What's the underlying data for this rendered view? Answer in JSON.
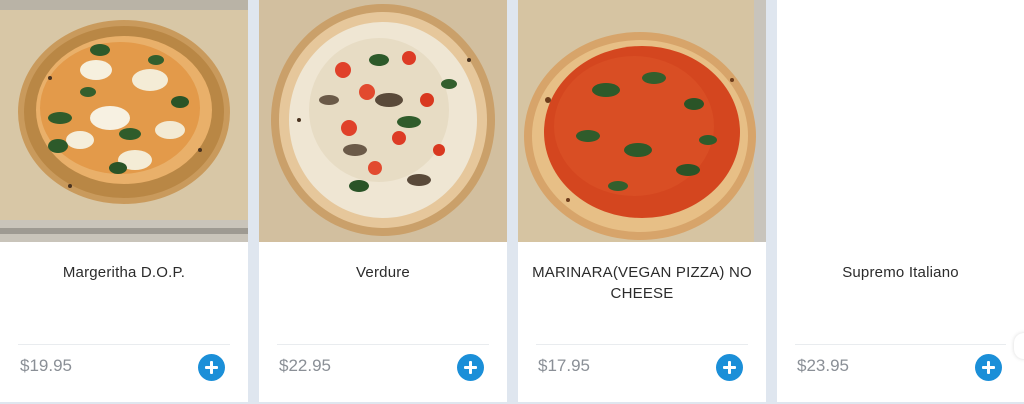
{
  "menu": {
    "items": [
      {
        "name": "Margeritha D.O.P.",
        "price": "$19.95",
        "image": "margherita-pizza-photo"
      },
      {
        "name": "Verdure",
        "price": "$22.95",
        "image": "verdure-pizza-photo"
      },
      {
        "name": "MARINARA(VEGAN PIZZA) NO CHEESE",
        "price": "$17.95",
        "image": "marinara-pizza-photo"
      },
      {
        "name": "Supremo Italiano",
        "price": "$23.95",
        "image": ""
      }
    ]
  },
  "colors": {
    "accent": "#1b8fd8",
    "price": "#8a8f96",
    "background": "#dfe6ef"
  },
  "icons": {
    "add": "plus-circle-icon"
  }
}
